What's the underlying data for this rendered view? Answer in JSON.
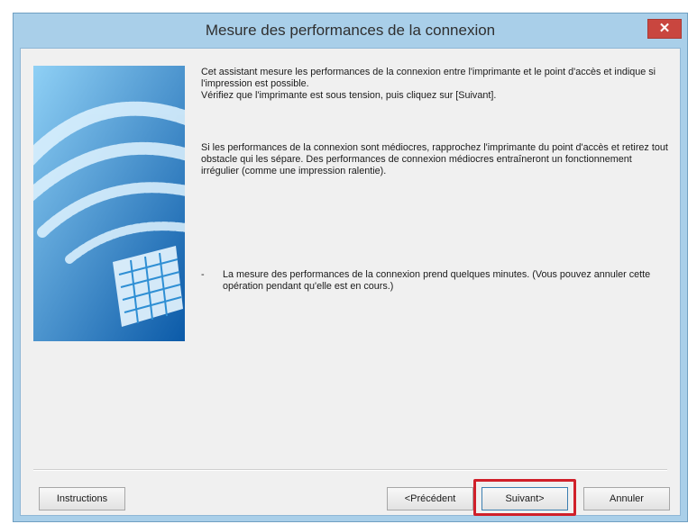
{
  "window": {
    "title": "Mesure des performances de la connexion",
    "close_label": "✕"
  },
  "content": {
    "paragraph1": "Cet assistant mesure les performances de la connexion entre l'imprimante et le point d'accès et indique si l'impression est possible.\nVérifiez que l'imprimante est sous tension, puis cliquez sur [Suivant].",
    "paragraph2": "Si les performances de la connexion sont médiocres, rapprochez l'imprimante du point d'accès et retirez tout obstacle qui les sépare. Des performances de connexion médiocres entraîneront un fonctionnement irrégulier (comme une impression ralentie).",
    "bullet_dash": "-",
    "bullet_text": "La mesure des performances de la connexion prend quelques minutes. (Vous pouvez annuler cette opération pendant qu'elle est en cours.)"
  },
  "buttons": {
    "instructions": "Instructions",
    "previous": "<Précédent",
    "next": "Suivant>",
    "cancel": "Annuler"
  },
  "illustration": {
    "icon": "wifi-signal-printer-icon"
  },
  "colors": {
    "window_frame": "#a9cfe9",
    "close_button": "#c9463f",
    "highlight": "#d0202a",
    "illustration_blue": "#2f8fd4"
  }
}
